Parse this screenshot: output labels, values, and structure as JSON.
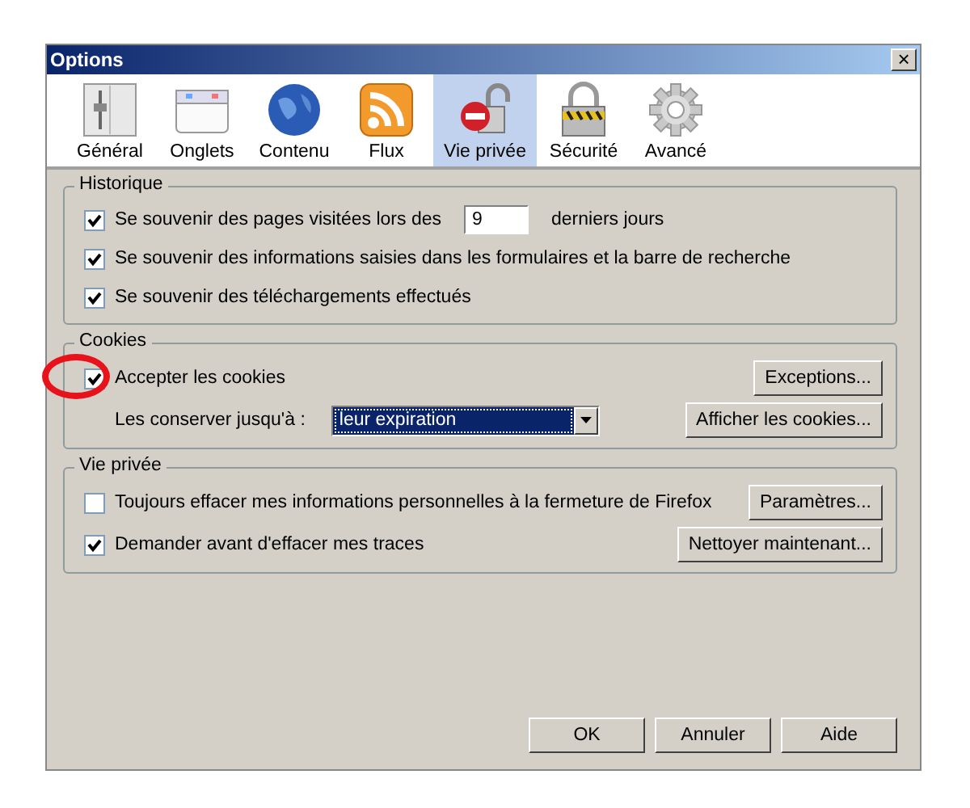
{
  "window": {
    "title": "Options",
    "close": "×"
  },
  "tabs": [
    {
      "label": "Général",
      "selected": false
    },
    {
      "label": "Onglets",
      "selected": false
    },
    {
      "label": "Contenu",
      "selected": false
    },
    {
      "label": "Flux",
      "selected": false
    },
    {
      "label": "Vie privée",
      "selected": true
    },
    {
      "label": "Sécurité",
      "selected": false
    },
    {
      "label": "Avancé",
      "selected": false
    }
  ],
  "history": {
    "title": "Historique",
    "items": [
      {
        "label": "Se souvenir des pages visitées lors des",
        "checked": true,
        "value": "9",
        "suffix": "derniers jours"
      },
      {
        "label": "Se souvenir des informations saisies dans les formulaires et la barre de recherche",
        "checked": true
      },
      {
        "label": "Se souvenir des téléchargements effectués",
        "checked": true
      }
    ]
  },
  "cookies": {
    "title": "Cookies",
    "accept": {
      "label": "Accepter les cookies",
      "checked": true,
      "button": "Exceptions...",
      "highlighted": true
    },
    "keep": {
      "label": "Les conserver jusqu'à :",
      "value": "leur expiration",
      "button": "Afficher les cookies..."
    }
  },
  "privacy": {
    "title": "Vie privée",
    "items": [
      {
        "label": "Toujours effacer mes informations personnelles à la fermeture de Firefox",
        "checked": false,
        "button": "Paramètres..."
      },
      {
        "label": "Demander avant d'effacer mes traces",
        "checked": true,
        "button": "Nettoyer maintenant..."
      }
    ]
  },
  "buttons": [
    "OK",
    "Annuler",
    "Aide"
  ]
}
